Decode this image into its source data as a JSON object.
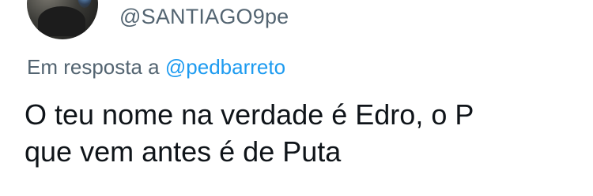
{
  "author": {
    "handle": "@SANTIAGO9pe",
    "avatar_icon": "user-avatar-photo"
  },
  "reply_context": {
    "prefix": "Em resposta a",
    "mention": "@pedbarreto"
  },
  "tweet": {
    "lines": [
      "O teu nome na verdade é Edro, o P",
      "que vem antes é de Puta"
    ]
  },
  "colors": {
    "secondary_text": "#536471",
    "mention_link": "#1d9bf0",
    "primary_text": "#0f1419",
    "background": "#ffffff"
  }
}
